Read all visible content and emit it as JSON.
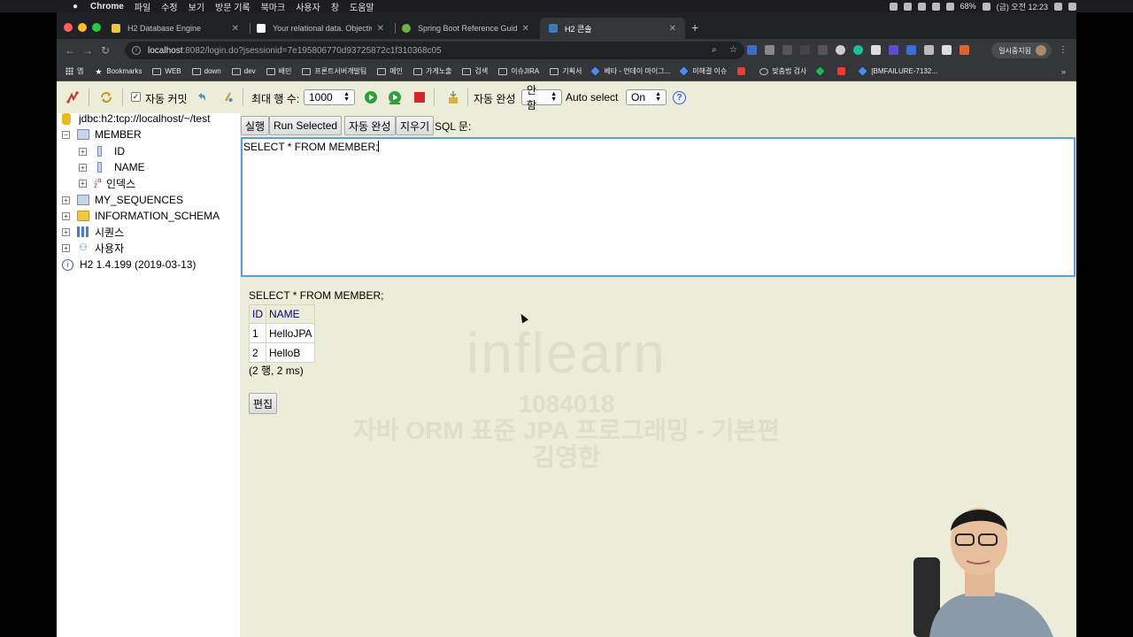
{
  "menubar": {
    "app": "Chrome",
    "items": [
      "파일",
      "수정",
      "보기",
      "방문 기록",
      "북마크",
      "사용자",
      "창",
      "도움말"
    ],
    "battery": "68%",
    "clock": "(금) 오전 12:23"
  },
  "tabs": [
    {
      "title": "H2 Database Engine",
      "favicon_color": "#e8c547"
    },
    {
      "title": "Your relational data. Objectivel",
      "favicon_color": "#ffffff"
    },
    {
      "title": "Spring Boot Reference Guide",
      "favicon_color": "#6db33f"
    },
    {
      "title": "H2 콘솔",
      "favicon_color": "#3b7bbf",
      "active": true
    }
  ],
  "browser": {
    "url_host": "localhost",
    "url_rest": ":8082/login.do?jsessionid=7e195806770d93725872c1f310368c05",
    "profile_label": "일시중지됨"
  },
  "bookmarks": [
    {
      "label": "앱",
      "icon": "apps-icon"
    },
    {
      "label": "Bookmarks",
      "icon": "star-icon"
    },
    {
      "label": "WEB",
      "icon": "folder-icon"
    },
    {
      "label": "down",
      "icon": "folder-icon"
    },
    {
      "label": "dev",
      "icon": "folder-icon"
    },
    {
      "label": "배민",
      "icon": "folder-icon"
    },
    {
      "label": "프론트서버개발팀",
      "icon": "folder-icon"
    },
    {
      "label": "메인",
      "icon": "folder-icon"
    },
    {
      "label": "가게노출",
      "icon": "folder-icon"
    },
    {
      "label": "검색",
      "icon": "folder-icon"
    },
    {
      "label": "이슈JIRA",
      "icon": "folder-icon"
    },
    {
      "label": "기획서",
      "icon": "folder-icon"
    },
    {
      "label": "베타 - 언데이 마이그...",
      "icon": "confluence-icon"
    },
    {
      "label": "미해결 이슈",
      "icon": "jira-icon"
    },
    {
      "label": "",
      "icon": "slack-icon"
    },
    {
      "label": "맞춤법 검사",
      "icon": "globe-icon"
    },
    {
      "label": "",
      "icon": "green-diamond-icon"
    },
    {
      "label": "",
      "icon": "pocket-icon"
    },
    {
      "label": "[BMFAILURE-7132...",
      "icon": "jira-icon"
    }
  ],
  "h2toolbar": {
    "autocommit_label": "자동 커밋",
    "autocommit_checked": "✓",
    "max_rows_label": "최대 행 수:",
    "max_rows_value": "1000",
    "autocomplete_label": "자동 완성",
    "autocomplete_value": "안함",
    "autoselect_label": "Auto select",
    "autoselect_value": "On",
    "help": "?"
  },
  "tree": {
    "connection": "jdbc:h2:tcp://localhost/~/test",
    "table": "MEMBER",
    "columns": [
      "ID",
      "NAME"
    ],
    "indexes": "인덱스",
    "other": [
      "MY_SEQUENCES",
      "INFORMATION_SCHEMA",
      "시퀀스",
      "사용자"
    ],
    "version": "H2 1.4.199 (2019-03-13)"
  },
  "query_bar": {
    "run": "실행",
    "run_selected": "Run Selected",
    "autocomplete": "자동 완성",
    "clear": "지우기",
    "sql_label": "SQL 문:"
  },
  "editor_sql": "SELECT * FROM MEMBER;",
  "result": {
    "query": "SELECT * FROM MEMBER;",
    "headers": [
      "ID",
      "NAME"
    ],
    "rows": [
      [
        "1",
        "HelloJPA"
      ],
      [
        "2",
        "HelloB"
      ]
    ],
    "summary": "(2 행, 2 ms)",
    "edit_button": "편집"
  },
  "watermark": {
    "logo": "inflearn",
    "id": "1084018",
    "course": "자바 ORM 표준 JPA 프로그래밍 - 기본편",
    "author": "김영한"
  }
}
